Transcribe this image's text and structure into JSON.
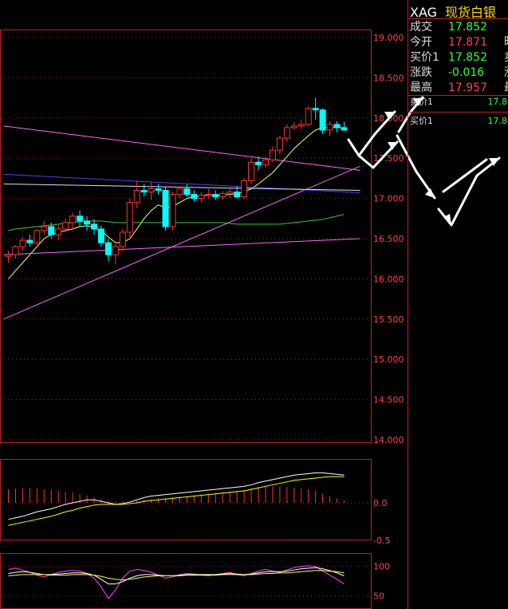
{
  "header": {
    "symbol": "XAG",
    "name": "现货白银"
  },
  "quote": [
    {
      "label": "成交",
      "value": "17.852",
      "color": "#33ff33",
      "extra": ""
    },
    {
      "label": "今开",
      "value": "17.871",
      "color": "#ff4444",
      "extra": "昨结"
    },
    {
      "label": "买价1",
      "value": "17.852",
      "color": "#33ff33",
      "extra": "卖价"
    },
    {
      "label": "涨跌",
      "value": "-0.016",
      "color": "#33ff33",
      "extra": "涨幅"
    },
    {
      "label": "最高",
      "value": "17.957",
      "color": "#ff4444",
      "extra": "最低"
    }
  ],
  "orderbook": [
    {
      "label": "卖价1",
      "value": "17.8"
    },
    {
      "label": "买价1",
      "value": "17.8"
    }
  ],
  "colors": {
    "up": "#ff3333",
    "down": "#00ffff",
    "grid": "#b22222",
    "axis_text": "#ff4444"
  },
  "chart_data": [
    {
      "type": "candlestick",
      "title": "",
      "y_ticks": [
        "14.000",
        "14.500",
        "15.000",
        "15.500",
        "16.000",
        "16.500",
        "17.000",
        "17.500",
        "18.000",
        "18.500",
        "19.000"
      ],
      "ylim": [
        14.0,
        19.0
      ],
      "candles": [
        [
          16.28,
          16.35,
          16.2,
          16.3
        ],
        [
          16.3,
          16.42,
          16.25,
          16.4
        ],
        [
          16.4,
          16.52,
          16.35,
          16.48
        ],
        [
          16.48,
          16.55,
          16.4,
          16.45
        ],
        [
          16.45,
          16.62,
          16.42,
          16.6
        ],
        [
          16.6,
          16.72,
          16.55,
          16.65
        ],
        [
          16.65,
          16.7,
          16.5,
          16.55
        ],
        [
          16.55,
          16.68,
          16.48,
          16.62
        ],
        [
          16.62,
          16.75,
          16.58,
          16.7
        ],
        [
          16.7,
          16.82,
          16.62,
          16.78
        ],
        [
          16.78,
          16.85,
          16.65,
          16.72
        ],
        [
          16.72,
          16.78,
          16.6,
          16.68
        ],
        [
          16.68,
          16.74,
          16.55,
          16.62
        ],
        [
          16.62,
          16.66,
          16.4,
          16.45
        ],
        [
          16.45,
          16.5,
          16.22,
          16.3
        ],
        [
          16.3,
          16.45,
          16.18,
          16.4
        ],
        [
          16.4,
          16.62,
          16.35,
          16.58
        ],
        [
          16.58,
          17.0,
          16.52,
          16.95
        ],
        [
          16.95,
          17.22,
          16.88,
          17.1
        ],
        [
          17.1,
          17.18,
          17.02,
          17.08
        ],
        [
          17.08,
          17.2,
          16.98,
          17.12
        ],
        [
          17.12,
          17.18,
          17.05,
          17.1
        ],
        [
          17.1,
          17.15,
          16.6,
          16.65
        ],
        [
          16.65,
          17.08,
          16.6,
          17.05
        ],
        [
          17.05,
          17.15,
          17.0,
          17.12
        ],
        [
          17.12,
          17.18,
          17.02,
          17.05
        ],
        [
          17.05,
          17.1,
          16.96,
          17.0
        ],
        [
          17.0,
          17.08,
          16.95,
          17.04
        ],
        [
          17.04,
          17.12,
          17.0,
          17.05
        ],
        [
          17.05,
          17.1,
          16.98,
          17.02
        ],
        [
          17.02,
          17.09,
          16.98,
          17.06
        ],
        [
          17.06,
          17.14,
          17.0,
          17.08
        ],
        [
          17.08,
          17.15,
          17.0,
          17.02
        ],
        [
          17.02,
          17.25,
          17.0,
          17.22
        ],
        [
          17.22,
          17.5,
          17.18,
          17.45
        ],
        [
          17.45,
          17.52,
          17.35,
          17.42
        ],
        [
          17.42,
          17.52,
          17.38,
          17.48
        ],
        [
          17.48,
          17.65,
          17.45,
          17.6
        ],
        [
          17.6,
          17.78,
          17.55,
          17.75
        ],
        [
          17.75,
          17.92,
          17.7,
          17.88
        ],
        [
          17.88,
          17.95,
          17.85,
          17.9
        ],
        [
          17.9,
          17.98,
          17.86,
          17.92
        ],
        [
          17.92,
          18.15,
          17.9,
          18.12
        ],
        [
          18.12,
          18.25,
          17.98,
          18.1
        ],
        [
          18.1,
          18.12,
          17.8,
          17.85
        ],
        [
          17.85,
          17.96,
          17.78,
          17.92
        ],
        [
          17.92,
          17.96,
          17.82,
          17.88
        ],
        [
          17.88,
          17.95,
          17.84,
          17.85
        ]
      ],
      "ma_lines": [
        {
          "values": [
            16.0,
            16.1,
            16.2,
            16.3,
            16.4,
            16.5,
            16.55,
            16.58,
            16.6,
            16.62,
            16.65,
            16.66,
            16.64,
            16.6,
            16.52,
            16.45,
            16.45,
            16.5,
            16.62,
            16.75,
            16.85,
            16.92,
            16.88,
            16.9,
            16.95,
            17.0,
            17.02,
            17.03,
            17.04,
            17.04,
            17.04,
            17.05,
            17.06,
            17.08,
            17.12,
            17.18,
            17.25,
            17.32,
            17.42,
            17.52,
            17.62,
            17.7,
            17.78,
            17.85,
            17.88,
            17.88,
            17.88,
            17.88
          ],
          "color": "#ffff66"
        },
        {
          "values": [
            16.6,
            16.62,
            16.63,
            16.64,
            16.65,
            16.66,
            16.67,
            16.68,
            16.69,
            16.7,
            16.71,
            16.72,
            16.72,
            16.72,
            16.71,
            16.7,
            16.7,
            16.7,
            16.7,
            16.7,
            16.7,
            16.7,
            16.7,
            16.7,
            16.7,
            16.7,
            16.7,
            16.7,
            16.7,
            16.7,
            16.7,
            16.69,
            16.68,
            16.68,
            16.68,
            16.68,
            16.68,
            16.68,
            16.68,
            16.69,
            16.7,
            16.71,
            16.72,
            16.73,
            16.74,
            16.76,
            16.78,
            16.8
          ],
          "color": "#33cc33"
        }
      ],
      "trend_lines": [
        {
          "from": [
            0,
            17.9
          ],
          "to": [
            47,
            17.35
          ],
          "color": "#ff66ff"
        },
        {
          "from": [
            0,
            15.5
          ],
          "to": [
            47,
            17.4
          ],
          "color": "#ff66ff"
        },
        {
          "from": [
            0,
            16.3
          ],
          "to": [
            47,
            16.5
          ],
          "color": "#ff66ff"
        },
        {
          "from": [
            0,
            17.3
          ],
          "to": [
            47,
            17.07
          ],
          "color": "#4444ff"
        },
        {
          "from": [
            0,
            17.18
          ],
          "to": [
            47,
            17.1
          ],
          "color": "#ddddff"
        }
      ]
    },
    {
      "type": "bar",
      "title": "",
      "y_ticks": [
        "0.0",
        "-0.5"
      ],
      "ylim": [
        -0.5,
        0.5
      ],
      "values": [
        0.18,
        0.19,
        0.2,
        0.2,
        0.19,
        0.18,
        0.17,
        0.16,
        0.15,
        0.14,
        0.12,
        0.1,
        0.07,
        0.05,
        0.03,
        0.02,
        0.02,
        0.02,
        0.03,
        0.04,
        0.05,
        0.06,
        0.06,
        0.07,
        0.08,
        0.09,
        0.1,
        0.11,
        0.12,
        0.13,
        0.14,
        0.15,
        0.16,
        0.17,
        0.19,
        0.21,
        0.22,
        0.22,
        0.22,
        0.21,
        0.2,
        0.19,
        0.18,
        0.16,
        0.12,
        0.09,
        0.06,
        0.03
      ],
      "lines": [
        {
          "values": [
            -0.22,
            -0.2,
            -0.18,
            -0.15,
            -0.12,
            -0.1,
            -0.08,
            -0.05,
            -0.02,
            0.0,
            0.02,
            0.04,
            0.04,
            0.02,
            0.0,
            -0.02,
            -0.01,
            0.01,
            0.04,
            0.07,
            0.09,
            0.1,
            0.11,
            0.12,
            0.13,
            0.14,
            0.15,
            0.16,
            0.17,
            0.18,
            0.19,
            0.2,
            0.21,
            0.22,
            0.24,
            0.27,
            0.29,
            0.31,
            0.33,
            0.35,
            0.37,
            0.38,
            0.39,
            0.4,
            0.4,
            0.39,
            0.38,
            0.37
          ],
          "color": "#ffffff"
        },
        {
          "values": [
            -0.3,
            -0.28,
            -0.26,
            -0.24,
            -0.22,
            -0.2,
            -0.18,
            -0.15,
            -0.12,
            -0.1,
            -0.07,
            -0.05,
            -0.03,
            -0.02,
            -0.02,
            -0.02,
            -0.02,
            -0.01,
            0.0,
            0.02,
            0.03,
            0.04,
            0.05,
            0.06,
            0.07,
            0.08,
            0.09,
            0.1,
            0.11,
            0.12,
            0.13,
            0.14,
            0.15,
            0.16,
            0.18,
            0.2,
            0.22,
            0.24,
            0.26,
            0.28,
            0.3,
            0.31,
            0.32,
            0.33,
            0.34,
            0.35,
            0.35,
            0.35
          ],
          "color": "#ffff00"
        }
      ]
    },
    {
      "type": "line",
      "title": "",
      "y_ticks": [
        "100",
        "50"
      ],
      "ylim": [
        30,
        120
      ],
      "series": [
        {
          "values": [
            95,
            97,
            94,
            90,
            85,
            82,
            86,
            90,
            92,
            93,
            92,
            88,
            80,
            65,
            45,
            60,
            80,
            92,
            95,
            93,
            90,
            85,
            80,
            82,
            86,
            88,
            87,
            85,
            84,
            86,
            88,
            90,
            86,
            84,
            88,
            92,
            95,
            92,
            90,
            94,
            98,
            100,
            101,
            100,
            92,
            85,
            78,
            70
          ],
          "color": "#ff44ff"
        },
        {
          "values": [
            88,
            90,
            91,
            90,
            88,
            86,
            86,
            87,
            88,
            89,
            89,
            88,
            85,
            78,
            70,
            70,
            74,
            80,
            84,
            86,
            86,
            85,
            84,
            84,
            85,
            86,
            86,
            86,
            86,
            86,
            87,
            88,
            87,
            86,
            87,
            89,
            91,
            91,
            91,
            92,
            94,
            96,
            97,
            98,
            96,
            93,
            89,
            84
          ],
          "color": "#ffffff"
        },
        {
          "values": [
            84,
            85,
            86,
            86,
            86,
            86,
            85,
            85,
            85,
            86,
            86,
            86,
            85,
            83,
            80,
            78,
            77,
            78,
            80,
            82,
            83,
            84,
            84,
            84,
            84,
            85,
            85,
            85,
            85,
            85,
            86,
            86,
            86,
            86,
            86,
            87,
            88,
            88,
            89,
            89,
            90,
            91,
            92,
            93,
            93,
            92,
            91,
            89
          ],
          "color": "#ffff44"
        }
      ]
    }
  ]
}
